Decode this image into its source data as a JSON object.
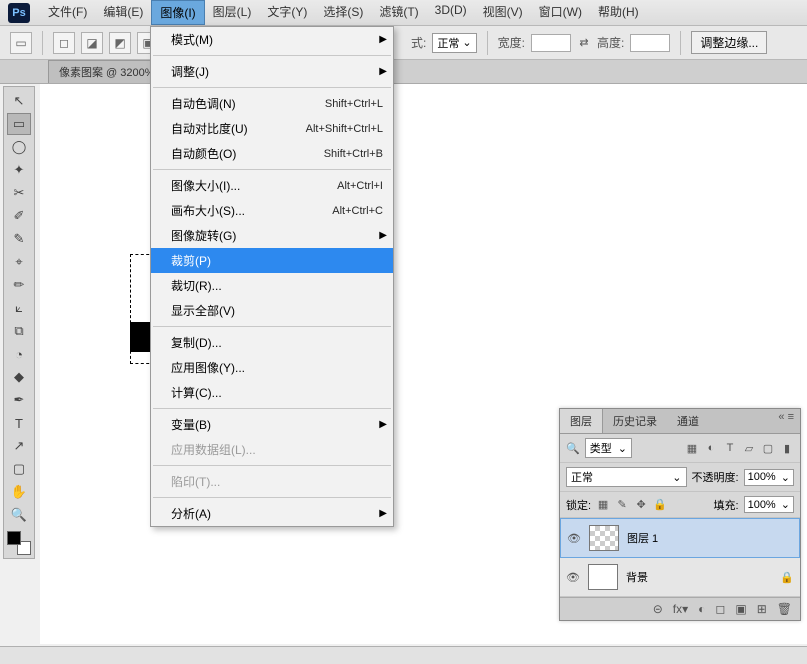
{
  "app": {
    "logo": "Ps"
  },
  "menubar": {
    "items": [
      "文件(F)",
      "编辑(E)",
      "图像(I)",
      "图层(L)",
      "文字(Y)",
      "选择(S)",
      "滤镜(T)",
      "3D(D)",
      "视图(V)",
      "窗口(W)",
      "帮助(H)"
    ],
    "active_index": 2
  },
  "optionsbar": {
    "mode_label": "式:",
    "mode_value": "正常",
    "width_label": "宽度:",
    "height_label": "高度:",
    "adjust_button": "调整边缘..."
  },
  "document_tab": "像素图案 @ 3200%",
  "dropdown": {
    "groups": [
      [
        {
          "label": "模式(M)",
          "shortcut": "",
          "submenu": true
        }
      ],
      [
        {
          "label": "调整(J)",
          "shortcut": "",
          "submenu": true
        }
      ],
      [
        {
          "label": "自动色调(N)",
          "shortcut": "Shift+Ctrl+L"
        },
        {
          "label": "自动对比度(U)",
          "shortcut": "Alt+Shift+Ctrl+L"
        },
        {
          "label": "自动颜色(O)",
          "shortcut": "Shift+Ctrl+B"
        }
      ],
      [
        {
          "label": "图像大小(I)...",
          "shortcut": "Alt+Ctrl+I"
        },
        {
          "label": "画布大小(S)...",
          "shortcut": "Alt+Ctrl+C"
        },
        {
          "label": "图像旋转(G)",
          "shortcut": "",
          "submenu": true
        },
        {
          "label": "裁剪(P)",
          "shortcut": "",
          "highlighted": true
        },
        {
          "label": "裁切(R)...",
          "shortcut": ""
        },
        {
          "label": "显示全部(V)",
          "shortcut": ""
        }
      ],
      [
        {
          "label": "复制(D)...",
          "shortcut": ""
        },
        {
          "label": "应用图像(Y)...",
          "shortcut": ""
        },
        {
          "label": "计算(C)...",
          "shortcut": ""
        }
      ],
      [
        {
          "label": "变量(B)",
          "shortcut": "",
          "submenu": true
        },
        {
          "label": "应用数据组(L)...",
          "shortcut": "",
          "disabled": true
        }
      ],
      [
        {
          "label": "陷印(T)...",
          "shortcut": "",
          "disabled": true
        }
      ],
      [
        {
          "label": "分析(A)",
          "shortcut": "",
          "submenu": true
        }
      ]
    ]
  },
  "tools": [
    "↖",
    "▭",
    "◯",
    "✦",
    "✂",
    "✐",
    "✎",
    "⌖",
    "✏",
    "⟀",
    "⧉",
    "◔",
    "◆",
    "✒",
    "T",
    "↗",
    "▢",
    "✋",
    "🔍"
  ],
  "tools_active_index": 1,
  "panel": {
    "tabs": [
      "图层",
      "历史记录",
      "通道"
    ],
    "active_tab": 0,
    "filter_label": "类型",
    "blend_mode": "正常",
    "opacity_label": "不透明度:",
    "opacity_value": "100%",
    "lock_label": "锁定:",
    "fill_label": "填充:",
    "fill_value": "100%",
    "layers": [
      {
        "name": "图层 1",
        "visible": true,
        "checker": true,
        "selected": true,
        "locked": false
      },
      {
        "name": "背景",
        "visible": true,
        "checker": false,
        "selected": false,
        "locked": true
      }
    ],
    "footer_icons": [
      "⊝",
      "fx▾",
      "◐",
      "◻",
      "▣",
      "⊞",
      "🗑"
    ]
  }
}
